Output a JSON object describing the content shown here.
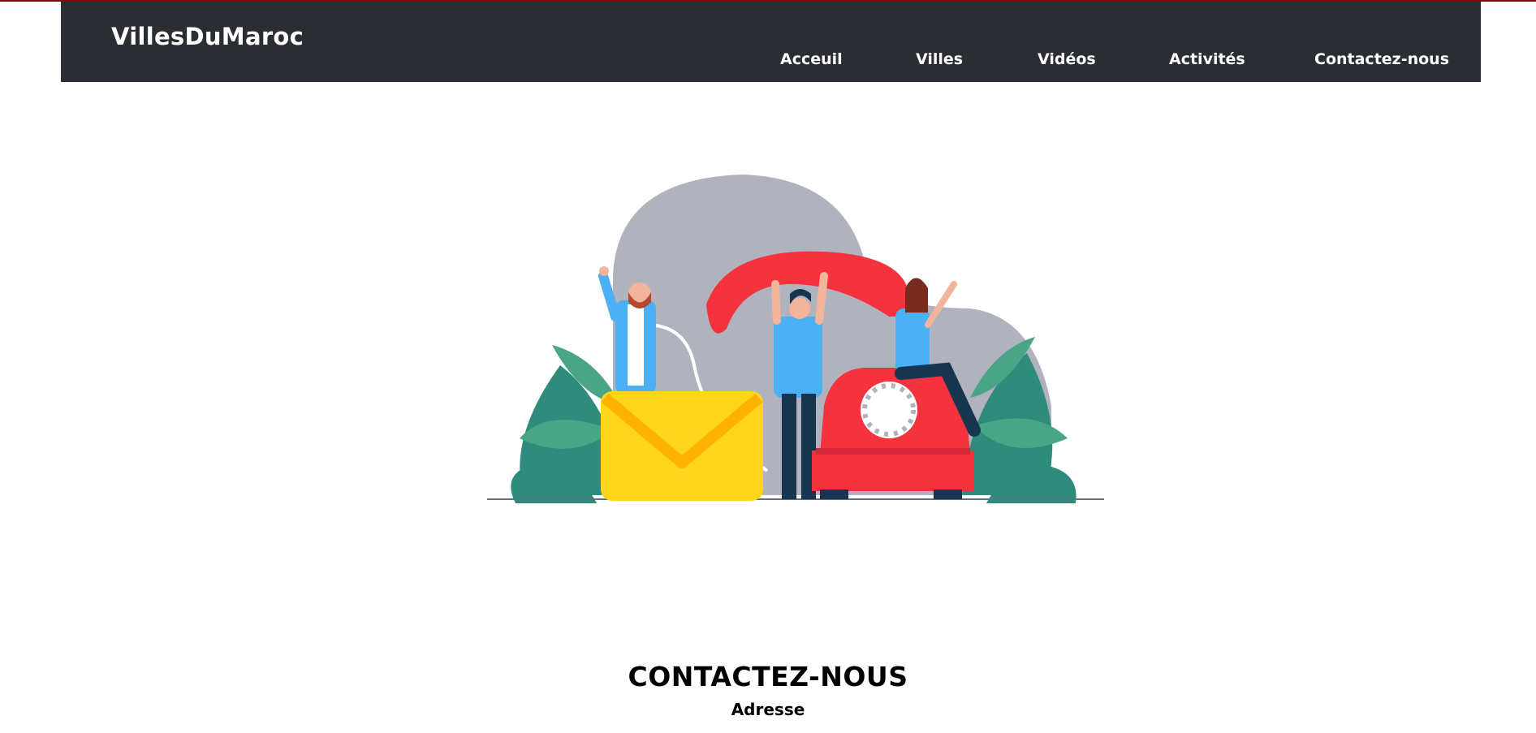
{
  "brand": "VillesDuMaroc",
  "nav": {
    "links": [
      "Acceuil",
      "Villes",
      "Vidéos",
      "Activités",
      "Contactez-nous"
    ]
  },
  "contact": {
    "title": "CONTACTEZ-NOUS",
    "subtitle": "Adresse"
  },
  "colors": {
    "navbar": "#2a2d31",
    "accent_red": "#f5333f",
    "envelope_yellow": "#ffd51e",
    "leaf_green": "#2f8b7b"
  },
  "illustration": "contact-illustration"
}
